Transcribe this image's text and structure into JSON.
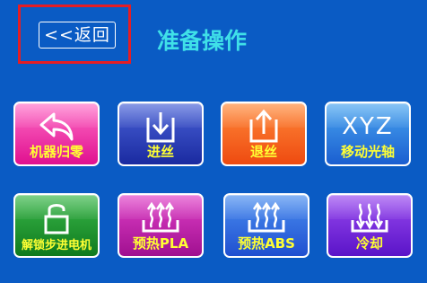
{
  "header": {
    "back_label": "<<返回",
    "title": "准备操作"
  },
  "tiles": [
    {
      "id": "home",
      "label": "机器归零",
      "icon": "return-arrow-icon",
      "color_top": "#ff6fc8",
      "color_bottom": "#e0108f"
    },
    {
      "id": "load",
      "label": "进丝",
      "icon": "download-tray-icon",
      "color_top": "#4a63d8",
      "color_bottom": "#1a2aa0"
    },
    {
      "id": "unload",
      "label": "退丝",
      "icon": "upload-tray-icon",
      "color_top": "#ff8a3a",
      "color_bottom": "#ee4a10"
    },
    {
      "id": "move",
      "label": "移动光轴",
      "icon": "xyz-text-icon",
      "icon_text": "XYZ",
      "color_top": "#4aa6f0",
      "color_bottom": "#1a5ed0"
    },
    {
      "id": "unlock",
      "label": "解锁步进电机",
      "icon": "unlock-padlock-icon",
      "color_top": "#3ab84a",
      "color_bottom": "#0f7a1e"
    },
    {
      "id": "preheat-pla",
      "label": "预热PLA",
      "icon": "heat-up-icon",
      "color_top": "#e040c8",
      "color_bottom": "#a01090"
    },
    {
      "id": "preheat-abs",
      "label": "预热ABS",
      "icon": "heat-up-icon",
      "color_top": "#4a8ef0",
      "color_bottom": "#2050d0"
    },
    {
      "id": "cool",
      "label": "冷却",
      "icon": "cool-down-icon",
      "color_top": "#9a4af0",
      "color_bottom": "#5a14c8"
    }
  ]
}
